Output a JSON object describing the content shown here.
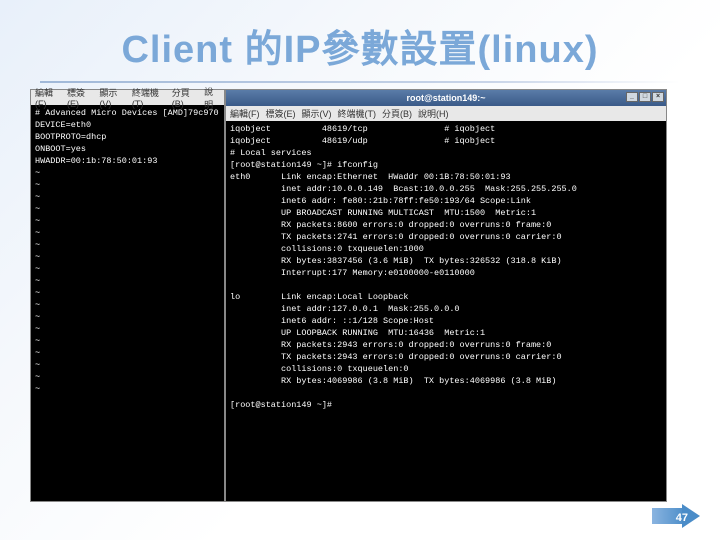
{
  "slide": {
    "title": "Client 的IP參數設置(linux)",
    "page_number": "47"
  },
  "terminal_right": {
    "titlebar": "root@station149:~",
    "window_buttons": {
      "min": "_",
      "max": "□",
      "close": "×"
    },
    "menu": [
      "編輯(F)",
      "標簽(E)",
      "顯示(V)",
      "終端機(T)",
      "分頁(B)",
      "說明(H)"
    ],
    "lines": [
      "iqobject          48619/tcp               # iqobject",
      "iqobject          48619/udp               # iqobject",
      "# Local services",
      "[root@station149 ~]# ifconfig",
      "eth0      Link encap:Ethernet  HWaddr 00:1B:78:50:01:93",
      "          inet addr:10.0.0.149  Bcast:10.0.0.255  Mask:255.255.255.0",
      "          inet6 addr: fe80::21b:78ff:fe50:193/64 Scope:Link",
      "          UP BROADCAST RUNNING MULTICAST  MTU:1500  Metric:1",
      "          RX packets:8600 errors:0 dropped:0 overruns:0 frame:0",
      "          TX packets:2741 errors:0 dropped:0 overruns:0 carrier:0",
      "          collisions:0 txqueuelen:1000",
      "          RX bytes:3837456 (3.6 MiB)  TX bytes:326532 (318.8 KiB)",
      "          Interrupt:177 Memory:e0100000-e0110000",
      "",
      "lo        Link encap:Local Loopback",
      "          inet addr:127.0.0.1  Mask:255.0.0.0",
      "          inet6 addr: ::1/128 Scope:Host",
      "          UP LOOPBACK RUNNING  MTU:16436  Metric:1",
      "          RX packets:2943 errors:0 dropped:0 overruns:0 frame:0",
      "          TX packets:2943 errors:0 dropped:0 overruns:0 carrier:0",
      "          collisions:0 txqueuelen:0",
      "          RX bytes:4069986 (3.8 MiB)  TX bytes:4069986 (3.8 MiB)",
      "",
      "[root@station149 ~]# "
    ]
  },
  "terminal_left": {
    "menu": [
      "編輯(F)",
      "標簽(E)",
      "顯示(V)",
      "終端機(T)",
      "分頁(B)",
      "說明"
    ],
    "lines": [
      "# Advanced Micro Devices [AMD]79c970",
      "DEVICE=eth0",
      "BOOTPROTO=dhcp",
      "ONBOOT=yes",
      "HWADDR=00:1b:78:50:01:93",
      "~",
      "~",
      "~",
      "~",
      "~",
      "~",
      "~",
      "~",
      "~",
      "~",
      "~",
      "~",
      "~",
      "~",
      "~",
      "~",
      "~",
      "~",
      "~"
    ]
  }
}
